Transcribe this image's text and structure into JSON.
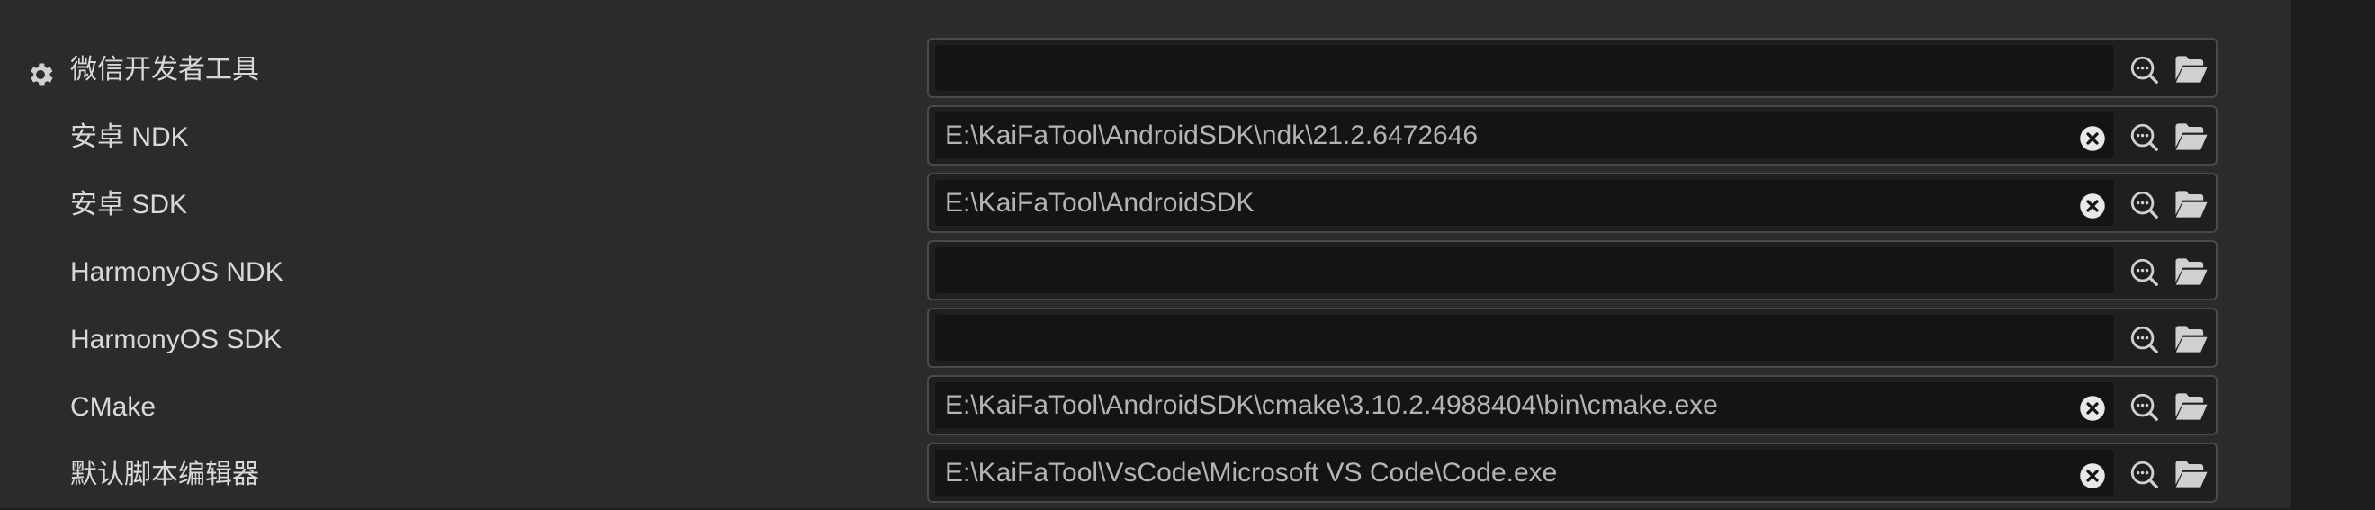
{
  "settings": {
    "rows": [
      {
        "label": "微信开发者工具",
        "value": "",
        "has_clear": false,
        "icon": "gear-icon"
      },
      {
        "label": "安卓 NDK",
        "value": "E:\\KaiFaTool\\AndroidSDK\\ndk\\21.2.6472646",
        "has_clear": true
      },
      {
        "label": "安卓 SDK",
        "value": "E:\\KaiFaTool\\AndroidSDK",
        "has_clear": true
      },
      {
        "label": "HarmonyOS NDK",
        "value": "",
        "has_clear": false
      },
      {
        "label": "HarmonyOS SDK",
        "value": "",
        "has_clear": false
      },
      {
        "label": "CMake",
        "value": "E:\\KaiFaTool\\AndroidSDK\\cmake\\3.10.2.4988404\\bin\\cmake.exe",
        "has_clear": true
      },
      {
        "label": "默认脚本编辑器",
        "value": "E:\\KaiFaTool\\VsCode\\Microsoft VS Code\\Code.exe",
        "has_clear": true
      }
    ],
    "icons": {
      "clear": "clear-icon",
      "search": "search-icon",
      "folder": "folder-open-icon"
    },
    "colors": {
      "background": "#2b2b2b",
      "field_bg": "#141414",
      "text": "#d8d8d8",
      "value_text": "#b4b4b4"
    }
  }
}
